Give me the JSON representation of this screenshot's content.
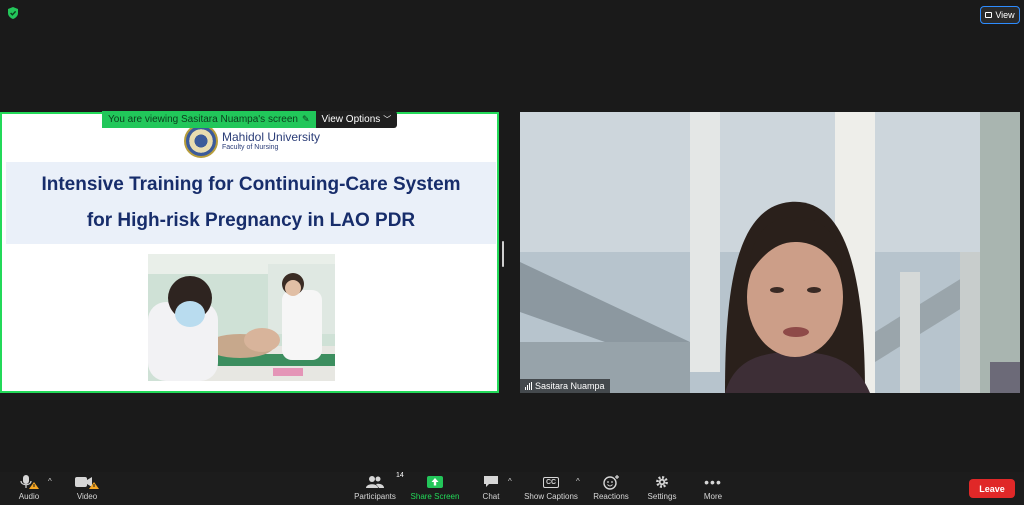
{
  "top": {
    "view_label": "View"
  },
  "share": {
    "banner_text": "You are viewing Sasitara Nuampa's screen",
    "view_options_label": "View Options",
    "slide": {
      "logo_university": "Mahidol University",
      "logo_faculty": "Faculty of Nursing",
      "title_line1": "Intensive Training for Continuing-Care System",
      "title_line2": "for High-risk Pregnancy in LAO PDR"
    }
  },
  "camera": {
    "participant_name": "Sasitara Nuampa"
  },
  "toolbar": {
    "audio_label": "Audio",
    "video_label": "Video",
    "participants_label": "Participants",
    "participants_count": "14",
    "share_screen_label": "Share Screen",
    "chat_label": "Chat",
    "captions_label": "Show Captions",
    "captions_badge": "CC",
    "reactions_label": "Reactions",
    "settings_label": "Settings",
    "more_label": "More",
    "leave_label": "Leave"
  },
  "colors": {
    "share_border": "#23d959",
    "leave": "#e02828",
    "accent_blue": "#2d8cff",
    "toolbar_bg": "#1c1c1c"
  }
}
